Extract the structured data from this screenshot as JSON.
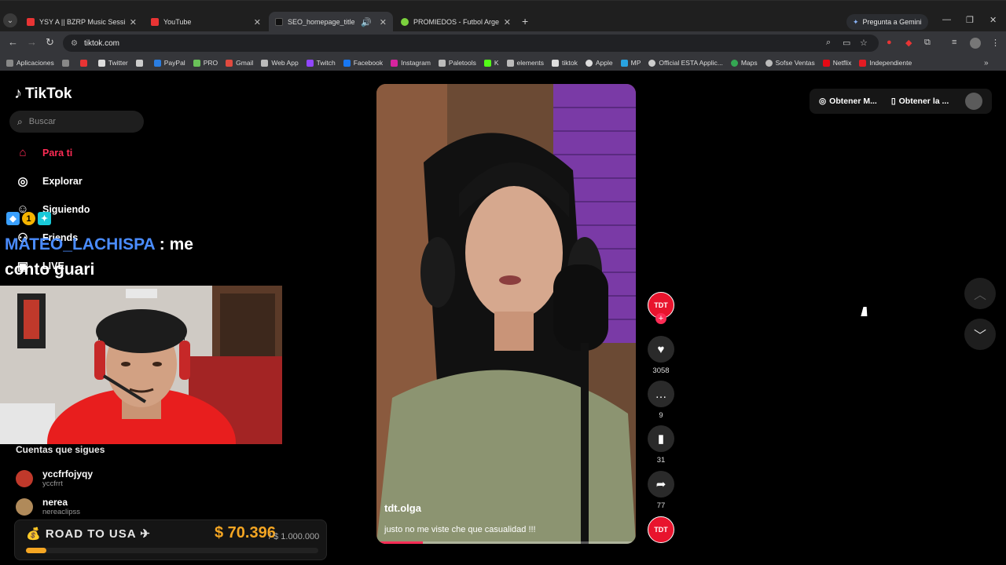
{
  "browser": {
    "tabs": [
      {
        "title": "YSY A || BZRP Music Sessions #",
        "color": "#e83434"
      },
      {
        "title": "YouTube",
        "color": "#e83434"
      },
      {
        "title": "SEO_homepage_title",
        "color": "#222222"
      },
      {
        "title": "PROMIEDOS - Futbol Argentina",
        "color": "#7bd13d"
      }
    ],
    "gemini_label": "Pregunta a Gemini",
    "url": "tiktok.com",
    "bookmarks": [
      {
        "label": "Aplicaciones",
        "color": "#888888"
      },
      {
        "label": "",
        "color": "#888888"
      },
      {
        "label": "",
        "color": "#e83434"
      },
      {
        "label": "Twitter",
        "color": "#dddddd"
      },
      {
        "label": "",
        "color": "#cccccc"
      },
      {
        "label": "PayPal",
        "color": "#2a7de1"
      },
      {
        "label": "PRO",
        "color": "#6ac259"
      },
      {
        "label": "Gmail",
        "color": "#e04a3f"
      },
      {
        "label": "Web App",
        "color": "#bbbbbb"
      },
      {
        "label": "Twitch",
        "color": "#9146ff"
      },
      {
        "label": "Facebook",
        "color": "#1877f2"
      },
      {
        "label": "Instagram",
        "color": "#d6249f"
      },
      {
        "label": "Paletools",
        "color": "#bbbbbb"
      },
      {
        "label": "K",
        "color": "#53fc18"
      },
      {
        "label": "elements",
        "color": "#bbbbbb"
      },
      {
        "label": "tiktok",
        "color": "#dddddd"
      },
      {
        "label": "Apple",
        "color": "#dddddd"
      },
      {
        "label": "MP",
        "color": "#29a3e0"
      },
      {
        "label": "Official ESTA Applic...",
        "color": "#cccccc"
      },
      {
        "label": "Maps",
        "color": "#34a853"
      },
      {
        "label": "Sofse Ventas",
        "color": "#bbbbbb"
      },
      {
        "label": "Netflix",
        "color": "#e50914"
      },
      {
        "label": "Independiente",
        "color": "#e31b23"
      }
    ]
  },
  "tiktok": {
    "logo": "TikTok",
    "search_placeholder": "Buscar",
    "nav": {
      "for_you": "Para ti",
      "explore": "Explorar",
      "following": "Siguiendo",
      "friends": "Friends",
      "live": "LIVE"
    },
    "following_title": "Cuentas que sigues",
    "accounts": [
      {
        "name": "yccfrfojyqy",
        "handle": "yccfrrt",
        "color": "#c0392b"
      },
      {
        "name": "nerea",
        "handle": "nereaclipss",
        "color": "#b08a5a"
      }
    ],
    "top_buttons": {
      "coins": "Obtener M...",
      "app": "Obtener la ..."
    },
    "video": {
      "author": "tdt.olga",
      "description": "justo no me viste che que casualidad !!!",
      "progress": 0.18,
      "creator_badge": "TDT"
    },
    "actions": {
      "likes": "3058",
      "comments": "9",
      "saves": "31",
      "shares": "77"
    }
  },
  "stream": {
    "chat_user": "MATEO_LACHISPA",
    "chat_message": ": me conto guari",
    "badge_number": "1",
    "goal_label": "ROAD TO USA",
    "goal_amount": "$ 70.396",
    "goal_target": "/ $ 1.000.000",
    "goal_progress": 0.07
  }
}
